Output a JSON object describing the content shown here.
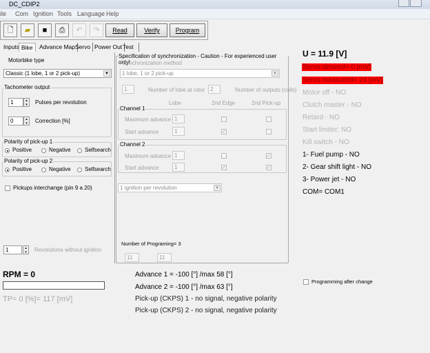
{
  "window": {
    "title": "DC_CDIP2"
  },
  "menu": [
    "ile",
    "Com",
    "Ignition",
    "Tools",
    "Language",
    "Help"
  ],
  "toolbar": {
    "icons": [
      "new-icon",
      "open-icon",
      "save-icon",
      "print-icon",
      "undo-icon",
      "redo-icon"
    ],
    "read": "Read",
    "verify": "Verify",
    "program": "Program"
  },
  "tabs": [
    "Inputs",
    "Bike",
    "Advance Map",
    "Servo",
    "Power Out",
    "Test"
  ],
  "bike": {
    "motorbike_type_label": "Motorbike type",
    "motorbike_type": "Classic (1 lobe, 1 or 2 pick-up)",
    "tacho": {
      "label": "Tachometer output",
      "pulses_value": "1",
      "pulses_label": "Pulses per revolution",
      "correction_value": "0",
      "correction_label": "Correction [%]"
    },
    "polarity1": {
      "label": "Polarity of pick-up 1",
      "selected": "Positive"
    },
    "polarity2": {
      "label": "Polarity of pick-up 2",
      "selected": "Positive"
    },
    "polarity_options": [
      "Positive",
      "Negative",
      "Selfsearch"
    ],
    "pickups_interchange": "Pickups interchange (pin 9 a 20)",
    "revolutions_value": "1",
    "revolutions_label": "Revolutions without ignition"
  },
  "sync": {
    "label": "Specification of synchronization - Caution - For experienced user only!",
    "method_label": "Synchronization method",
    "method": "1 lobe, 1 or 2 pick-up",
    "lobes_value": "1",
    "lobes_label": "Number of lobe at rotor",
    "outputs_value": "2",
    "outputs_label": "Number of outputs (coils)",
    "col_lobe": "Lobe",
    "col_edge": "2nd Edge",
    "col_pickup": "2nd Pick-up",
    "max_adv": "Maximum advance",
    "start_adv": "Start advance",
    "channel1": {
      "label": "Channel 1",
      "max": "1",
      "start": "1",
      "max_edge": false,
      "max_pickup": false,
      "start_edge": true,
      "start_pickup": false
    },
    "channel2": {
      "label": "Channel 2",
      "max": "1",
      "start": "1",
      "max_edge": false,
      "max_pickup": true,
      "start_edge": true,
      "start_pickup": true
    },
    "ignition": "1 ignition per revolution",
    "programming_count": "Number of Programing= 3",
    "prog1": "11",
    "prog2": "11"
  },
  "status": {
    "voltage": "U = 11.9 [V]",
    "servo_desired": "Servo desired= 0 [mV]",
    "servo_measured": "Servo measured= 24 [mV]",
    "inactive": [
      "Motor off - NO",
      "Clutch master - NO",
      "Retard - NO",
      "Start limiter: NO",
      "Kill switch - NO"
    ],
    "active": [
      "1- Fuel pump - NO",
      "2- Gear shift light - NO",
      "3- Power jet - NO",
      "COM= COM1"
    ],
    "highlight_color": "#ff0000"
  },
  "bottom": {
    "rpm": "RPM = 0",
    "rpm_progress": 0,
    "tp": "TP= 0 [%]= 117 [mV]",
    "adv1": "Advance 1 = -100 [°] /max 58 [°]",
    "adv2": "Advance 2 = -100 [°] /max 63 [°]",
    "pickup1": "Pick-up (CKPS) 1 - no signal, negative polarity",
    "pickup2": "Pick-up (CKPS) 2 - no signal, negative polarity",
    "prog_after_change": "Programming after change"
  }
}
